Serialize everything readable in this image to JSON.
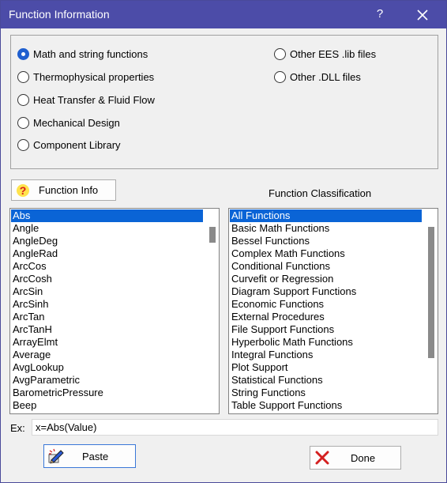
{
  "window": {
    "title": "Function Information",
    "help_label": "?"
  },
  "categories": [
    {
      "label": "Math and string functions",
      "checked": true
    },
    {
      "label": "Thermophysical properties",
      "checked": false
    },
    {
      "label": "Heat Transfer & Fluid Flow",
      "checked": false
    },
    {
      "label": "Mechanical Design",
      "checked": false
    },
    {
      "label": "Component Library",
      "checked": false
    },
    {
      "label": "Other EES .lib files",
      "checked": false
    },
    {
      "label": "Other .DLL files",
      "checked": false
    }
  ],
  "function_info_button": {
    "label": "Function Info"
  },
  "classification_heading": "Function Classification",
  "functions_list": {
    "selected": "Abs",
    "items": [
      "Abs",
      "Angle",
      "AngleDeg",
      "AngleRad",
      "ArcCos",
      "ArcCosh",
      "ArcSin",
      "ArcSinh",
      "ArcTan",
      "ArcTanH",
      "ArrayElmt",
      "Average",
      "AvgLookup",
      "AvgParametric",
      "BarometricPressure",
      "Beep"
    ]
  },
  "classification_list": {
    "selected": "All Functions",
    "items": [
      "All Functions",
      "Basic Math Functions",
      "Bessel Functions",
      "Complex Math Functions",
      "Conditional Functions",
      "Curvefit or Regression",
      "Diagram Support Functions",
      "Economic Functions",
      "External Procedures",
      "File Support Functions",
      "Hyperbolic Math Functions",
      "Integral Functions",
      "Plot Support",
      "Statistical Functions",
      "String Functions",
      "Table Support Functions"
    ]
  },
  "example": {
    "label": "Ex:",
    "value": "x=Abs(Value)"
  },
  "buttons": {
    "paste": "Paste",
    "done": "Done"
  },
  "colors": {
    "titlebar": "#4c4ca8",
    "selection": "#0a64d6",
    "radio_checked": "#1f5fcf",
    "done_icon": "#d42020"
  }
}
